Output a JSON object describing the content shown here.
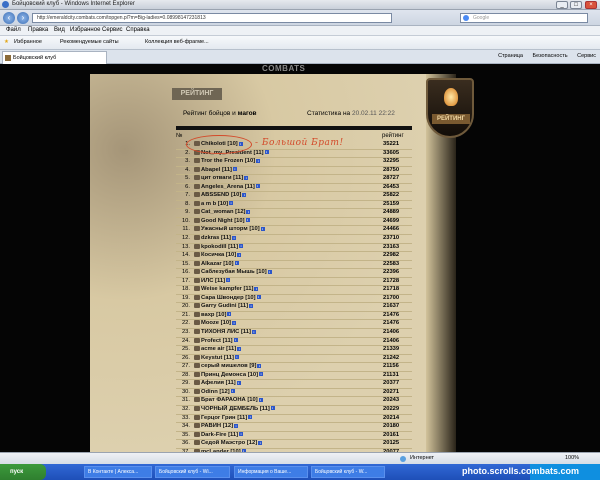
{
  "window": {
    "title": "Бойцовский клуб - Windows Internet Explorer"
  },
  "address": {
    "url": "http://emeraldcity.combats.com/topgen.pl?m=Big-ladies=0.08998147231813",
    "search_placeholder": "Google"
  },
  "menu": [
    "Файл",
    "Правка",
    "Вид",
    "Избранное",
    "Сервис",
    "Справка"
  ],
  "favorites": {
    "label": "Избранное",
    "items": [
      "Рекомендуемые сайты",
      "Коллекция веб-фрагме..."
    ]
  },
  "tab": {
    "title": "Бойцовский клуб"
  },
  "tab_tools": [
    "Страница",
    "Безопасность",
    "Сервис"
  ],
  "page": {
    "site_logo": "COMBATS",
    "plaque": "РЕЙТИНГ",
    "shield_label": "РЕЙТИНГ",
    "heading_prefix": "Рейтинг бойцов и",
    "heading_strong": "магов",
    "stats_prefix": "Статистика на",
    "stats_date": "20.02.11 22:22",
    "col_num": "№",
    "col_rating": "рейтинг",
    "annotation": "- Большой Брат!",
    "rows": [
      {
        "n": "1.",
        "nick": "Chikoloti",
        "lvl": "[10]",
        "rating": "35221"
      },
      {
        "n": "2.",
        "nick": "Not_my_President",
        "lvl": "[11]",
        "rating": "33605"
      },
      {
        "n": "3.",
        "nick": "Tror the Frozen",
        "lvl": "[10]",
        "rating": "32295"
      },
      {
        "n": "4.",
        "nick": "Abapel",
        "lvl": "[11]",
        "rating": "28750"
      },
      {
        "n": "5.",
        "nick": "цит отваги",
        "lvl": "[11]",
        "rating": "28727"
      },
      {
        "n": "6.",
        "nick": "Angeles_Arena",
        "lvl": "[11]",
        "rating": "26453"
      },
      {
        "n": "7.",
        "nick": "ABSSEND",
        "lvl": "[10]",
        "rating": "25822"
      },
      {
        "n": "8.",
        "nick": "a m b",
        "lvl": "[10]",
        "rating": "25159"
      },
      {
        "n": "9.",
        "nick": "Cat_woman",
        "lvl": "[12]",
        "rating": "24889"
      },
      {
        "n": "10.",
        "nick": "Good Night",
        "lvl": "[10]",
        "rating": "24699"
      },
      {
        "n": "11.",
        "nick": "Ужасный шторм",
        "lvl": "[10]",
        "rating": "24466"
      },
      {
        "n": "12.",
        "nick": "dzkras",
        "lvl": "[11]",
        "rating": "23710"
      },
      {
        "n": "13.",
        "nick": "kpokodill",
        "lvl": "[11]",
        "rating": "23163"
      },
      {
        "n": "14.",
        "nick": "Косичка",
        "lvl": "[10]",
        "rating": "22982"
      },
      {
        "n": "15.",
        "nick": "Alkazar",
        "lvl": "[10]",
        "rating": "22583"
      },
      {
        "n": "16.",
        "nick": "Саблезубая Мышь",
        "lvl": "[10]",
        "rating": "22396"
      },
      {
        "n": "17.",
        "nick": "ИЛС",
        "lvl": "[11]",
        "rating": "21728"
      },
      {
        "n": "18.",
        "nick": "Weise kampfer",
        "lvl": "[11]",
        "rating": "21718"
      },
      {
        "n": "19.",
        "nick": "Сара Швондер",
        "lvl": "[10]",
        "rating": "21700"
      },
      {
        "n": "20.",
        "nick": "Garry Gudini",
        "lvl": "[11]",
        "rating": "21637"
      },
      {
        "n": "21.",
        "nick": "вахр",
        "lvl": "[10]",
        "rating": "21476"
      },
      {
        "n": "22.",
        "nick": "Mooze",
        "lvl": "[10]",
        "rating": "21476"
      },
      {
        "n": "23.",
        "nick": "ТИХОНЯ ЛИС",
        "lvl": "[11]",
        "rating": "21406"
      },
      {
        "n": "24.",
        "nick": "Profect",
        "lvl": "[11]",
        "rating": "21406"
      },
      {
        "n": "25.",
        "nick": "acme air",
        "lvl": "[11]",
        "rating": "21339"
      },
      {
        "n": "26.",
        "nick": "Keystut",
        "lvl": "[11]",
        "rating": "21242"
      },
      {
        "n": "27.",
        "nick": "серый мишелов",
        "lvl": "[9]",
        "rating": "21156"
      },
      {
        "n": "28.",
        "nick": "Принц Демонса",
        "lvl": "[10]",
        "rating": "21131"
      },
      {
        "n": "29.",
        "nick": "Афелия",
        "lvl": "[11]",
        "rating": "20377"
      },
      {
        "n": "30.",
        "nick": "Odinn",
        "lvl": "[12]",
        "rating": "20271"
      },
      {
        "n": "31.",
        "nick": "Брат ФАРАОНА",
        "lvl": "[10]",
        "rating": "20243"
      },
      {
        "n": "32.",
        "nick": "ЧОРНЫЙ ДЕМБЕЛЬ",
        "lvl": "[11]",
        "rating": "20229"
      },
      {
        "n": "33.",
        "nick": "Герцог Грин",
        "lvl": "[11]",
        "rating": "20214"
      },
      {
        "n": "34.",
        "nick": "РАВИН",
        "lvl": "[12]",
        "rating": "20180"
      },
      {
        "n": "35.",
        "nick": "Dark-Fire",
        "lvl": "[11]",
        "rating": "20161"
      },
      {
        "n": "36.",
        "nick": "Седой Маэстро",
        "lvl": "[12]",
        "rating": "20125"
      },
      {
        "n": "37.",
        "nick": "mcLander",
        "lvl": "[10]",
        "rating": "20077"
      }
    ]
  },
  "status": {
    "zone": "Интернет",
    "zoom": "100%"
  },
  "taskbar": {
    "start": "пуск",
    "tasks": [
      "В Контакте | Алекса...",
      "Бойцовский клуб - Wi...",
      "Информация о Ваше...",
      "Бойцовский клуб - W..."
    ]
  },
  "watermark": "photo.scrolls.combats.com"
}
